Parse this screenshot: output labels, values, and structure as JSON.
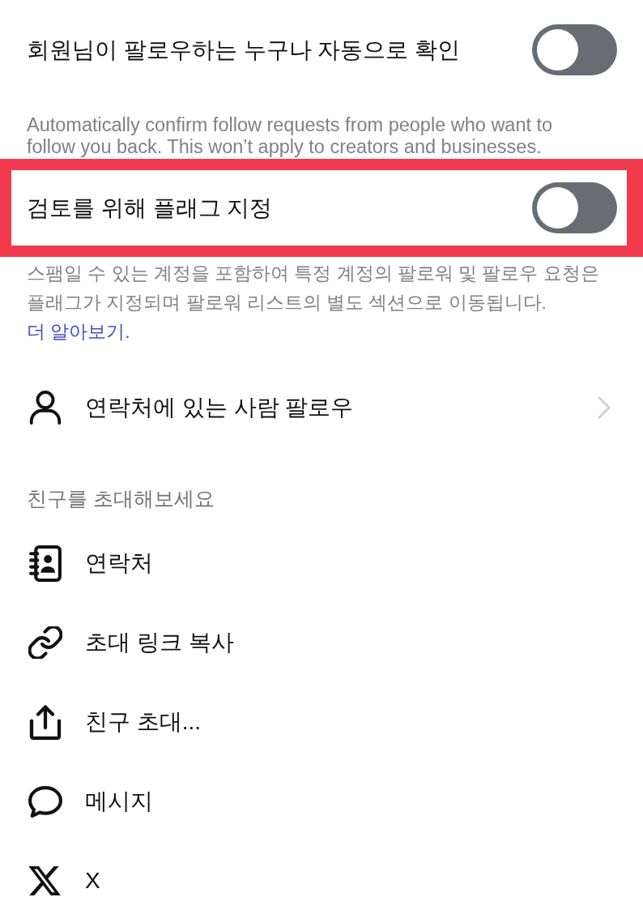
{
  "settings": [
    {
      "label": "회원님이 팔로우하는 누구나 자동으로 확인",
      "on": false,
      "highlighted": false,
      "description": "Automatically confirm follow requests from people who want to follow you back. This won’t apply to creators and businesses."
    },
    {
      "label": "검토를 위해 플래그 지정",
      "on": false,
      "highlighted": true,
      "description": "스팸일 수 있는 계정을 포함하여 특정 계정의 팔로워 및 팔로우 요청은 플래그가 지정되며 팔로워 리스트의 별도 섹션으로 이동됩니다.",
      "link": "더 알아보기."
    }
  ],
  "follow_contacts": {
    "label": "연락처에 있는 사람 팔로우"
  },
  "invite_section": {
    "title": "친구를 초대해보세요",
    "items": [
      {
        "kind": "contacts",
        "label": "연락처"
      },
      {
        "kind": "link",
        "label": "초대 링크 복사"
      },
      {
        "kind": "share",
        "label": "친구 초대..."
      },
      {
        "kind": "message",
        "label": "메시지"
      },
      {
        "kind": "x",
        "label": "X"
      }
    ]
  }
}
